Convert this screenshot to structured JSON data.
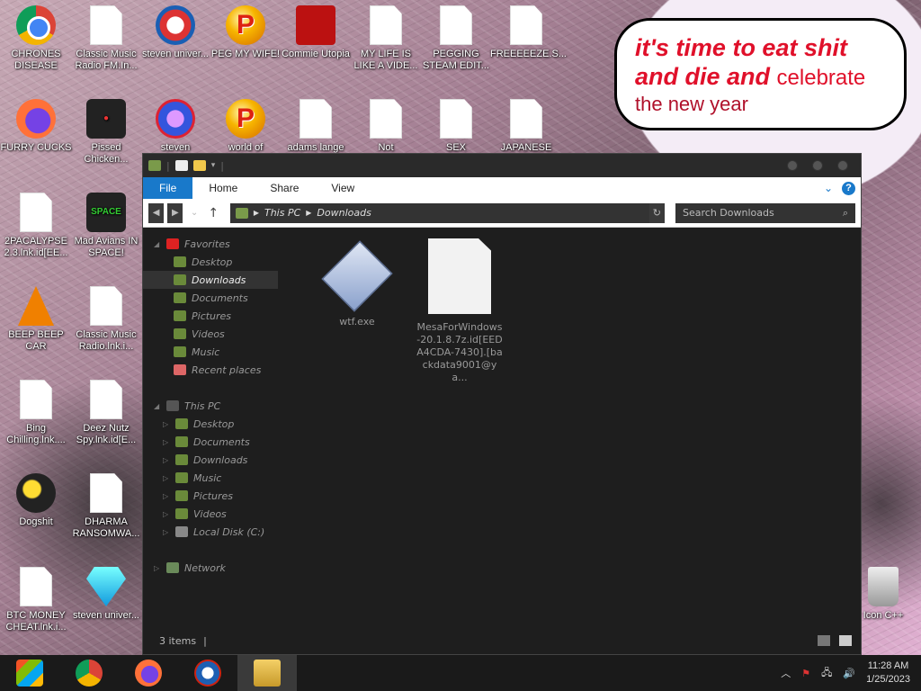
{
  "desktop": {
    "icons": [
      {
        "label": "CHRONES DISEASE"
      },
      {
        "label": "Classic Music Radio FM.In..."
      },
      {
        "label": "steven univer..."
      },
      {
        "label": "PEG MY WIFE!"
      },
      {
        "label": "Commie Utopia"
      },
      {
        "label": "MY LIFE IS LIKE A VIDE..."
      },
      {
        "label": "PEGGING STEAM EDIT..."
      },
      {
        "label": "FREEEEEZE.S..."
      },
      {
        "label": "FURRY CUCKS"
      },
      {
        "label": "Pissed Chicken..."
      },
      {
        "label": "steven"
      },
      {
        "label": "world of"
      },
      {
        "label": "adams lange"
      },
      {
        "label": "Not"
      },
      {
        "label": "SEX"
      },
      {
        "label": "JAPANESE"
      },
      {
        "label": "2PACALYPSE 2.3.lnk.id[EE..."
      },
      {
        "label": "Mad Avians IN SPACE!"
      },
      {
        "label": "BEEP BEEP CAR"
      },
      {
        "label": "Classic Music Radio.lnk.i..."
      },
      {
        "label": "Bing Chilling.lnk...."
      },
      {
        "label": "Deez Nutz Spy.lnk.id[E..."
      },
      {
        "label": "Dogshit"
      },
      {
        "label": "DHARMA RANSOMWA..."
      },
      {
        "label": "BTC MONEY CHEAT.lnk.i..."
      },
      {
        "label": "steven univer..."
      },
      {
        "label": "Icon C++"
      }
    ],
    "bubble": {
      "line1": "it's time to eat shit",
      "line2": "and die and",
      "line2b": "celebrate",
      "line3": "the new year"
    }
  },
  "explorer": {
    "ribbon": {
      "file": "File",
      "home": "Home",
      "share": "Share",
      "view": "View"
    },
    "address": {
      "root": "This PC",
      "current": "Downloads"
    },
    "search": {
      "placeholder": "Search Downloads"
    },
    "nav": {
      "favorites": "Favorites",
      "fav_items": [
        "Desktop",
        "Downloads",
        "Documents",
        "Pictures",
        "Videos",
        "Music",
        "Recent places"
      ],
      "thispc": "This PC",
      "pc_items": [
        "Desktop",
        "Documents",
        "Downloads",
        "Music",
        "Pictures",
        "Videos",
        "Local Disk (C:)"
      ],
      "network": "Network"
    },
    "files": [
      {
        "name": "wtf.exe"
      },
      {
        "name": "MesaForWindows-20.1.8.7z.id[EEDA4CDA-7430].[backdata9001@ya..."
      }
    ],
    "status": "3 items"
  },
  "taskbar": {
    "time": "11:28 AM",
    "date": "1/25/2023"
  }
}
